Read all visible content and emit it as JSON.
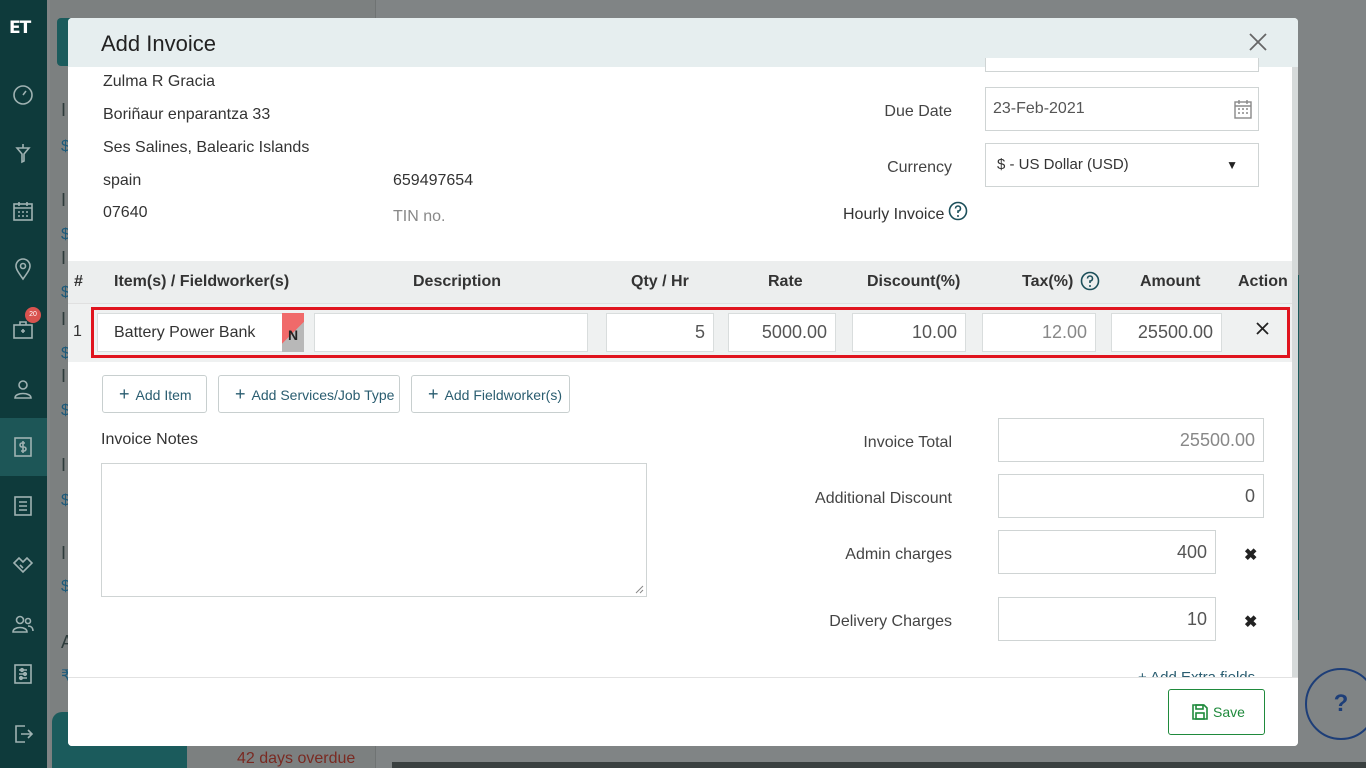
{
  "sidebar": {
    "logo": "ET",
    "badge": "20",
    "icons": [
      "dashboard-icon",
      "funnel-icon",
      "calendar-icon",
      "map-pin-icon",
      "briefcase-icon",
      "user-icon",
      "invoice-icon",
      "list-icon",
      "handshake-icon",
      "users-icon",
      "settings-sliders-icon",
      "logout-icon"
    ]
  },
  "background": {
    "letter_i": "I",
    "letter_a": "A",
    "dollar": "$",
    "rupee": "₹",
    "overdue_text": "42 days overdue",
    "help": "?"
  },
  "modal": {
    "title": "Add Invoice",
    "customer": {
      "name": "Zulma R Gracia",
      "address1": "Boriñaur enparantza 33",
      "address2": "Ses Salines, Balearic Islands",
      "country": "spain",
      "zip": "07640",
      "phone": "659497654",
      "tin_label": "TIN no."
    },
    "due_date_label": "Due Date",
    "due_date_value": "23-Feb-2021",
    "currency_label": "Currency",
    "currency_value": "$ - US Dollar (USD)",
    "hourly_label": "Hourly Invoice",
    "table": {
      "headers": {
        "num": "#",
        "item": "Item(s) / Fieldworker(s)",
        "description": "Description",
        "qty": "Qty / Hr",
        "rate": "Rate",
        "discount": "Discount(%)",
        "tax": "Tax(%)",
        "amount": "Amount",
        "action": "Action"
      },
      "row": {
        "num": "1",
        "item": "Battery Power Bank",
        "tag": "N",
        "description": "",
        "qty": "5",
        "rate": "5000.00",
        "discount": "10.00",
        "tax": "12.00",
        "amount": "25500.00"
      }
    },
    "buttons": {
      "add_item": "Add Item",
      "add_services": "Add Services/Job Type",
      "add_fieldworker": "Add Fieldworker(s)",
      "save": "Save"
    },
    "notes_label": "Invoice Notes",
    "totals": {
      "invoice_total_label": "Invoice Total",
      "invoice_total": "25500.00",
      "additional_discount_label": "Additional Discount",
      "additional_discount": "0",
      "admin_charges_label": "Admin charges",
      "admin_charges": "400",
      "delivery_charges_label": "Delivery Charges",
      "delivery_charges": "10"
    },
    "add_extra_fields": "+ Add Extra fields"
  }
}
